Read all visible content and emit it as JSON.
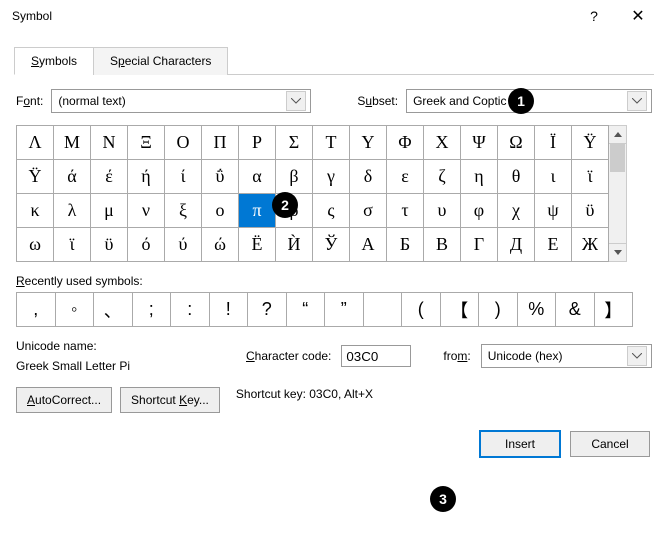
{
  "titlebar": {
    "title": "Symbol",
    "help": "?",
    "close": "✕"
  },
  "tabs": {
    "symbols": "Symbols",
    "special": "Special Characters"
  },
  "font": {
    "label_pre": "F",
    "label_u": "o",
    "label_post": "nt:",
    "value": "(normal text)"
  },
  "subset": {
    "label_pre": "S",
    "label_u": "u",
    "label_post": "bset:",
    "value": "Greek and Coptic"
  },
  "grid": [
    "Λ",
    "Μ",
    "Ν",
    "Ξ",
    "Ο",
    "Π",
    "Ρ",
    "Σ",
    "Τ",
    "Υ",
    "Φ",
    "Χ",
    "Ψ",
    "Ω",
    "Ϊ",
    "Ϋ",
    "Ϋ",
    "ά",
    "έ",
    "ή",
    "ί",
    "ΰ",
    "α",
    "β",
    "γ",
    "δ",
    "ε",
    "ζ",
    "η",
    "θ",
    "ι",
    "ϊ",
    "κ",
    "λ",
    "μ",
    "ν",
    "ξ",
    "ο",
    "π",
    "ρ",
    "ς",
    "σ",
    "τ",
    "υ",
    "φ",
    "χ",
    "ψ",
    "ϋ",
    "ω",
    "ϊ",
    "ϋ",
    "ό",
    "ύ",
    "ώ",
    "Ё",
    "Ѝ",
    "Ў",
    "А",
    "Б",
    "В",
    "Г",
    "Д",
    "Е",
    "Ж"
  ],
  "selected_index": 38,
  "recent_label_pre": "",
  "recent_label_u": "R",
  "recent_label_post": "ecently used symbols:",
  "recent": [
    ",",
    "◦",
    "、",
    ";",
    ":",
    "!",
    "?",
    "“",
    "”",
    "",
    "(",
    "【",
    ")",
    "%",
    "&",
    "】"
  ],
  "unicode_name_label": "Unicode name:",
  "unicode_name": "Greek Small Letter Pi",
  "charcode": {
    "label_pre": "",
    "label_u": "C",
    "label_post": "haracter code:",
    "value": "03C0"
  },
  "from": {
    "label_pre": "fro",
    "label_u": "m",
    "label_post": ":",
    "value": "Unicode (hex)"
  },
  "autocorrect": {
    "pre": "",
    "u": "A",
    "post": "utoCorrect..."
  },
  "shortcutkey": {
    "pre": "Shortcut ",
    "u": "K",
    "post": "ey..."
  },
  "shortcut_text": "Shortcut key: 03C0, Alt+X",
  "insert": "Insert",
  "cancel": "Cancel",
  "callouts": {
    "c1": "1",
    "c2": "2",
    "c3": "3"
  }
}
